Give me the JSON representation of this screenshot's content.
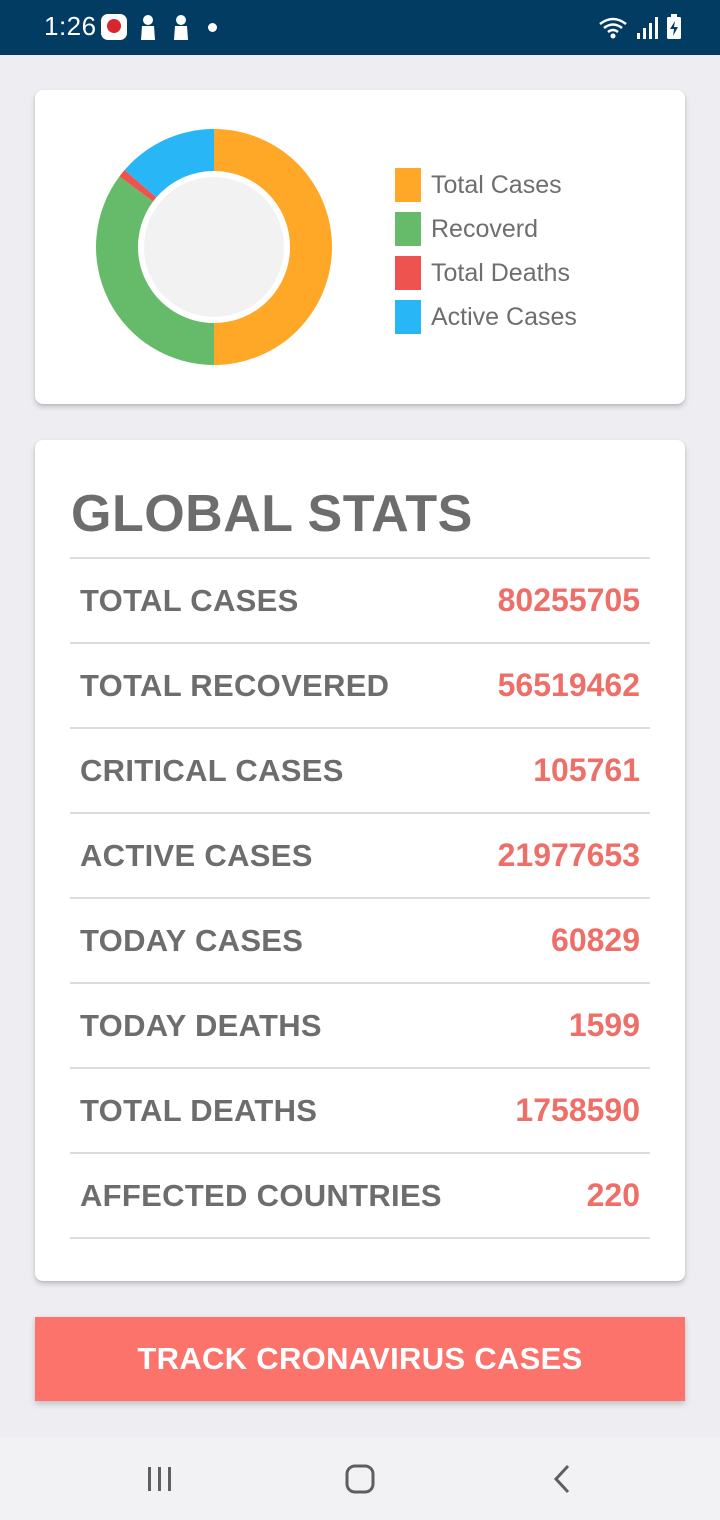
{
  "status_bar": {
    "time": "1:26",
    "icons": [
      "app-badge-icon",
      "person-icon",
      "person-icon",
      "dot-icon",
      "wifi-icon",
      "signal-icon",
      "battery-charging-icon"
    ]
  },
  "chart_data": {
    "type": "pie",
    "style": "donut",
    "legend_placement": "right",
    "categories": [
      "Total Cases",
      "Recoverd",
      "Total Deaths",
      "Active Cases"
    ],
    "values": [
      80255705,
      56519462,
      1758590,
      21977653
    ],
    "colors": [
      "#ffa726",
      "#66bb6a",
      "#ef5350",
      "#29b6f6"
    ]
  },
  "legend": [
    {
      "label": "Total Cases",
      "color": "#ffa726"
    },
    {
      "label": "Recoverd",
      "color": "#66bb6a"
    },
    {
      "label": "Total Deaths",
      "color": "#ef5350"
    },
    {
      "label": "Active Cases",
      "color": "#29b6f6"
    }
  ],
  "stats": {
    "title": "GLOBAL STATS",
    "rows": [
      {
        "label": "TOTAL CASES",
        "value": "80255705"
      },
      {
        "label": "TOTAL RECOVERED",
        "value": "56519462"
      },
      {
        "label": "CRITICAL CASES",
        "value": "105761"
      },
      {
        "label": "ACTIVE CASES",
        "value": "21977653"
      },
      {
        "label": "TODAY CASES",
        "value": "60829"
      },
      {
        "label": "TODAY DEATHS",
        "value": "1599"
      },
      {
        "label": "TOTAL DEATHS",
        "value": "1758590"
      },
      {
        "label": "AFFECTED COUNTRIES",
        "value": "220"
      }
    ]
  },
  "track_button": {
    "label": "TRACK CRONAVIRUS CASES"
  },
  "nav_bar": {
    "icons": [
      "recent-apps-icon",
      "home-icon",
      "back-icon"
    ]
  },
  "colors": {
    "status_bar": "#023c63",
    "accent": "#fb736b",
    "stat_value": "#ee6e68"
  }
}
